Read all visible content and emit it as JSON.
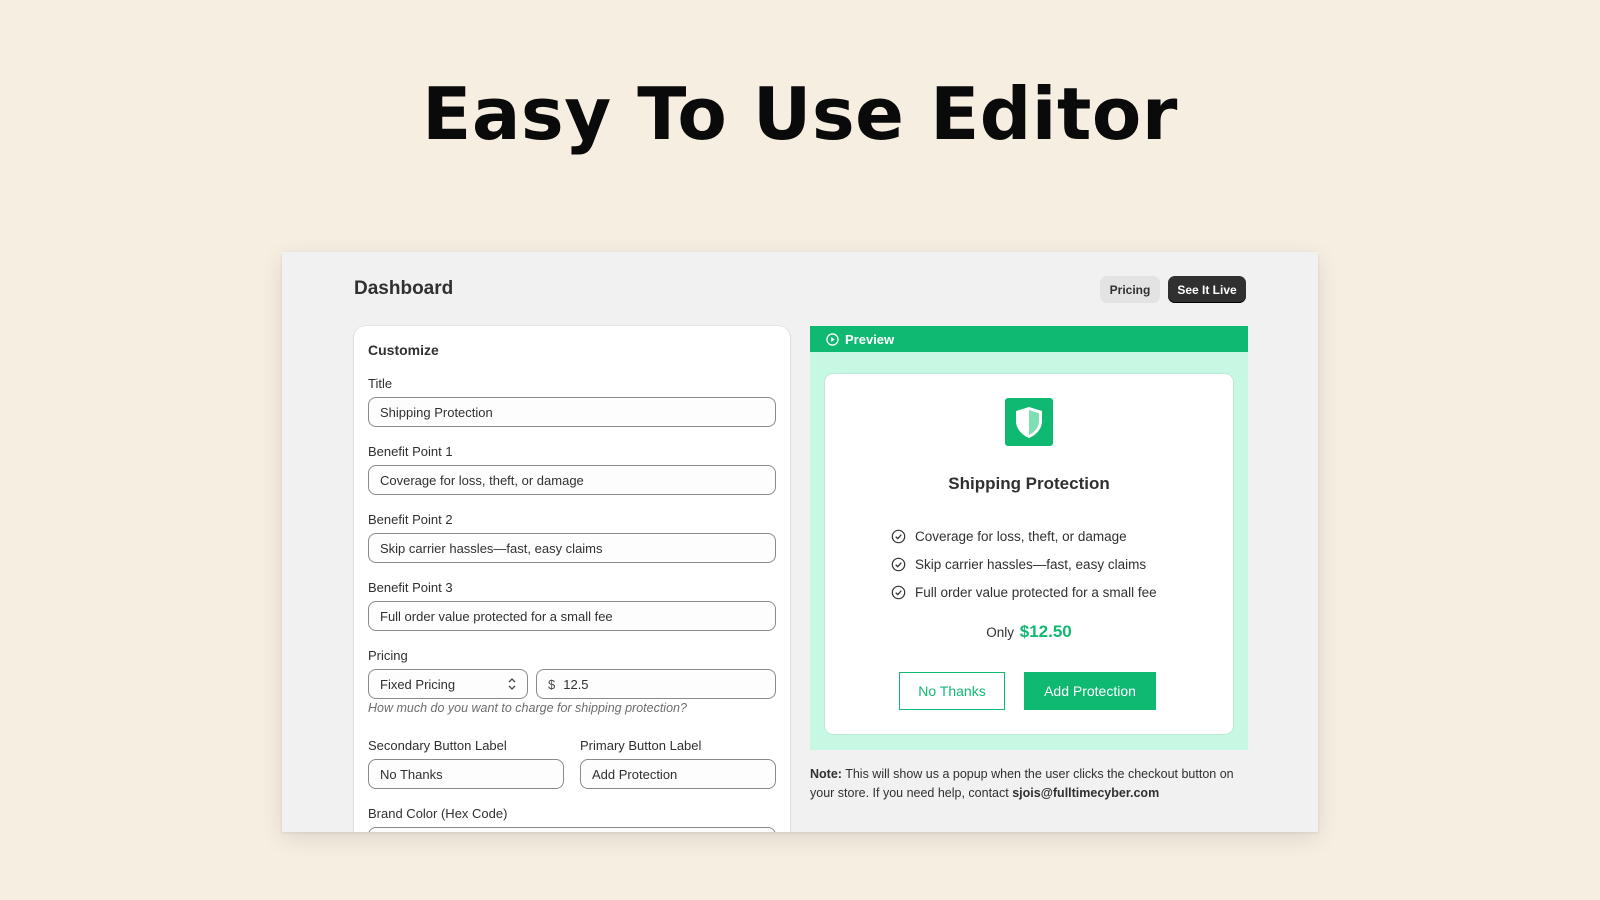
{
  "hero": {
    "title": "Easy To Use Editor"
  },
  "header": {
    "title": "Dashboard",
    "pricing_button": "Pricing",
    "live_button": "See It Live"
  },
  "customize": {
    "title": "Customize",
    "fields": {
      "title": {
        "label": "Title",
        "value": "Shipping Protection"
      },
      "benefit1": {
        "label": "Benefit Point 1",
        "value": "Coverage for loss, theft, or damage"
      },
      "benefit2": {
        "label": "Benefit Point 2",
        "value": "Skip carrier hassles—fast, easy claims"
      },
      "benefit3": {
        "label": "Benefit Point 3",
        "value": "Full order value protected for a small fee"
      },
      "pricing": {
        "label": "Pricing",
        "type_value": "Fixed Pricing",
        "currency": "$",
        "amount": "12.5",
        "help": "How much do you want to charge for shipping protection?"
      },
      "secondary_button": {
        "label": "Secondary Button Label",
        "value": "No Thanks"
      },
      "primary_button": {
        "label": "Primary Button Label",
        "value": "Add Protection"
      },
      "brand_color": {
        "label": "Brand Color (Hex Code)"
      }
    }
  },
  "preview": {
    "bar_label": "Preview",
    "popup": {
      "title": "Shipping Protection",
      "benefits": [
        "Coverage for loss, theft, or damage",
        "Skip carrier hassles—fast, easy claims",
        "Full order value protected for a small fee"
      ],
      "price_prefix": "Only",
      "price": "$12.50",
      "secondary_button": "No Thanks",
      "primary_button": "Add Protection"
    }
  },
  "note": {
    "label": "Note:",
    "text": "This will show us a popup when the user clicks the checkout button on your store. If you need help, contact",
    "email": "sjois@fulltimecyber.com"
  },
  "colors": {
    "background": "#f6eee1",
    "accent": "#10b971",
    "preview_bg": "#c6f8e3",
    "dark_button": "#303030"
  },
  "icons": [
    "play-circle-icon",
    "shield-icon",
    "check-circle-icon",
    "select-arrows-icon"
  ]
}
